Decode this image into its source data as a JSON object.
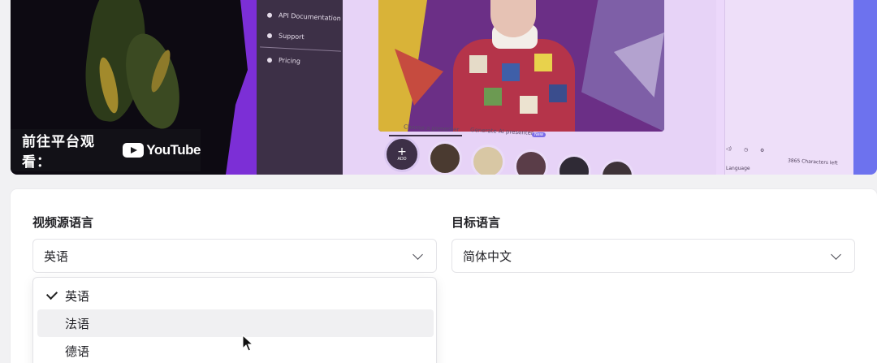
{
  "video": {
    "sidebar_items": [
      {
        "label": "API Documentation",
        "icon": "doc-icon"
      },
      {
        "label": "Support",
        "icon": "support-icon"
      },
      {
        "label": "Pricing",
        "icon": "pricing-icon"
      }
    ],
    "tabs": [
      "Choose a presenter",
      "Generate AI presenter"
    ],
    "tab_badge": "New",
    "add_label": "ADD",
    "chars_left": "3865 Characters left",
    "language_label": "Language",
    "overlay_text": "前往平台观看：",
    "overlay_brand": "YouTube"
  },
  "form": {
    "source_label": "视频源语言",
    "source_value": "英语",
    "target_label": "目标语言",
    "target_value": "简体中文",
    "options": [
      {
        "label": "英语",
        "selected": true,
        "hover": false
      },
      {
        "label": "法语",
        "selected": false,
        "hover": true
      },
      {
        "label": "德语",
        "selected": false,
        "hover": false
      }
    ]
  },
  "colors": {
    "accent_purple": "#7c2fd6",
    "overlay_bg": "#141418"
  }
}
